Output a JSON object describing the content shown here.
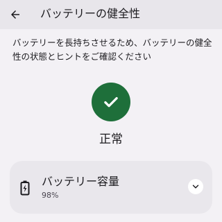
{
  "header": {
    "title": "バッテリーの健全性",
    "back_icon": "arrow-back-icon"
  },
  "description": "バッテリーを長持ちさせるため、バッテリーの健全性の状態とヒントをご確認ください",
  "status": {
    "icon": "check-icon",
    "label": "正常",
    "color": "#1e6f3a"
  },
  "capacity_card": {
    "icon": "battery-charging-icon",
    "title": "バッテリー容量",
    "value": "98%",
    "expand_icon": "chevron-down-icon"
  },
  "colors": {
    "background": "#f3f1f5",
    "app_bar": "#e8e6eb",
    "card": "#e9e7ec",
    "accent_green": "#1e6f3a"
  }
}
